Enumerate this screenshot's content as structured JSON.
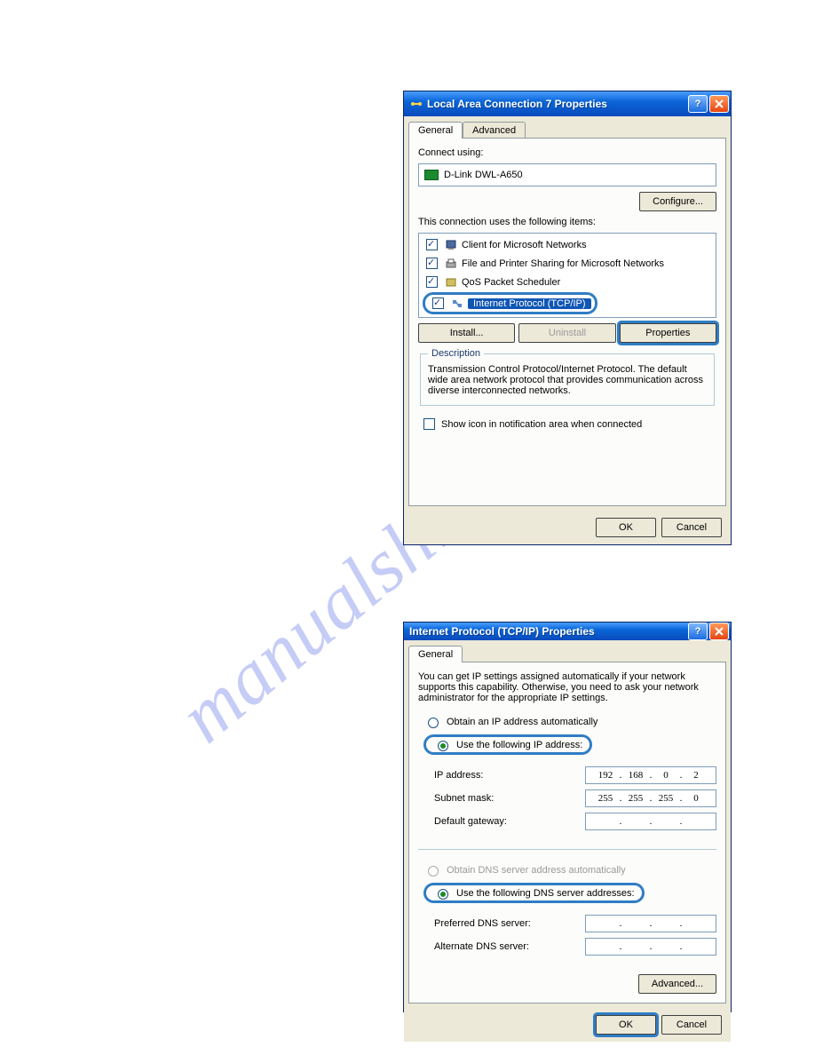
{
  "watermark": "manualshive.com",
  "dialog1": {
    "title": "Local Area Connection 7 Properties",
    "tabs": {
      "general": "General",
      "advanced": "Advanced"
    },
    "connect_using_label": "Connect using:",
    "adapter_name": "D-Link DWL-A650",
    "configure_btn": "Configure...",
    "items_label": "This connection uses the following items:",
    "items": {
      "client": "Client for Microsoft Networks",
      "fps": "File and Printer Sharing for Microsoft Networks",
      "qos": "QoS Packet Scheduler",
      "tcpip": "Internet Protocol (TCP/IP)"
    },
    "install_btn": "Install...",
    "uninstall_btn": "Uninstall",
    "properties_btn": "Properties",
    "desc_legend": "Description",
    "desc_text": "Transmission Control Protocol/Internet Protocol. The default wide area network protocol that provides communication across diverse interconnected networks.",
    "show_icon": "Show icon in notification area when connected",
    "ok": "OK",
    "cancel": "Cancel"
  },
  "dialog2": {
    "title": "Internet Protocol (TCP/IP) Properties",
    "tab": "General",
    "blurb": "You can get IP settings assigned automatically if your network supports this capability. Otherwise, you need to ask your network administrator for the appropriate IP settings.",
    "obtain_ip": "Obtain an IP address automatically",
    "use_ip": "Use the following IP address:",
    "ip_label": "IP address:",
    "subnet_label": "Subnet mask:",
    "gw_label": "Default gateway:",
    "obtain_dns": "Obtain DNS server address automatically",
    "use_dns": "Use the following DNS server addresses:",
    "pref_dns": "Preferred DNS server:",
    "alt_dns": "Alternate DNS server:",
    "ip": {
      "o1": "192",
      "o2": "168",
      "o3": "0",
      "o4": "2"
    },
    "mask": {
      "o1": "255",
      "o2": "255",
      "o3": "255",
      "o4": "0"
    },
    "advanced_btn": "Advanced...",
    "ok": "OK",
    "cancel": "Cancel"
  }
}
